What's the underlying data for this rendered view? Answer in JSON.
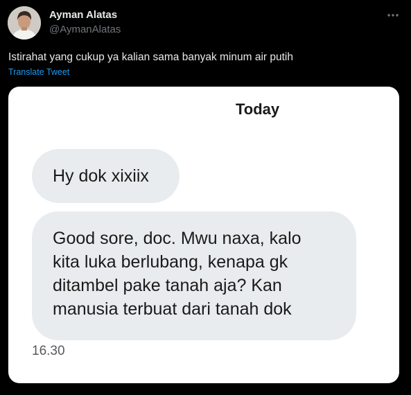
{
  "tweet": {
    "author": {
      "display_name": "Ayman Alatas",
      "handle": "@AymanAlatas"
    },
    "text": "Istirahat yang cukup ya kalian sama banyak minum air putih",
    "translate_label": "Translate Tweet",
    "more_icon": "more-horizontal-icon"
  },
  "media": {
    "chat": {
      "date_header": "Today",
      "messages": [
        {
          "text": "Hy dok xixiix"
        },
        {
          "text": "Good sore, doc. Mwu naxa, kalo\nkita luka berlubang, kenapa gk\nditambel pake tanah aja? Kan\nmanusia terbuat dari tanah dok"
        }
      ],
      "time": "16.30"
    }
  },
  "colors": {
    "background": "#000000",
    "primary_text": "#e7e9ea",
    "secondary_text": "#71767b",
    "link": "#1d9bf0",
    "bubble": "#e9ecee",
    "media_background": "#ffffff"
  }
}
